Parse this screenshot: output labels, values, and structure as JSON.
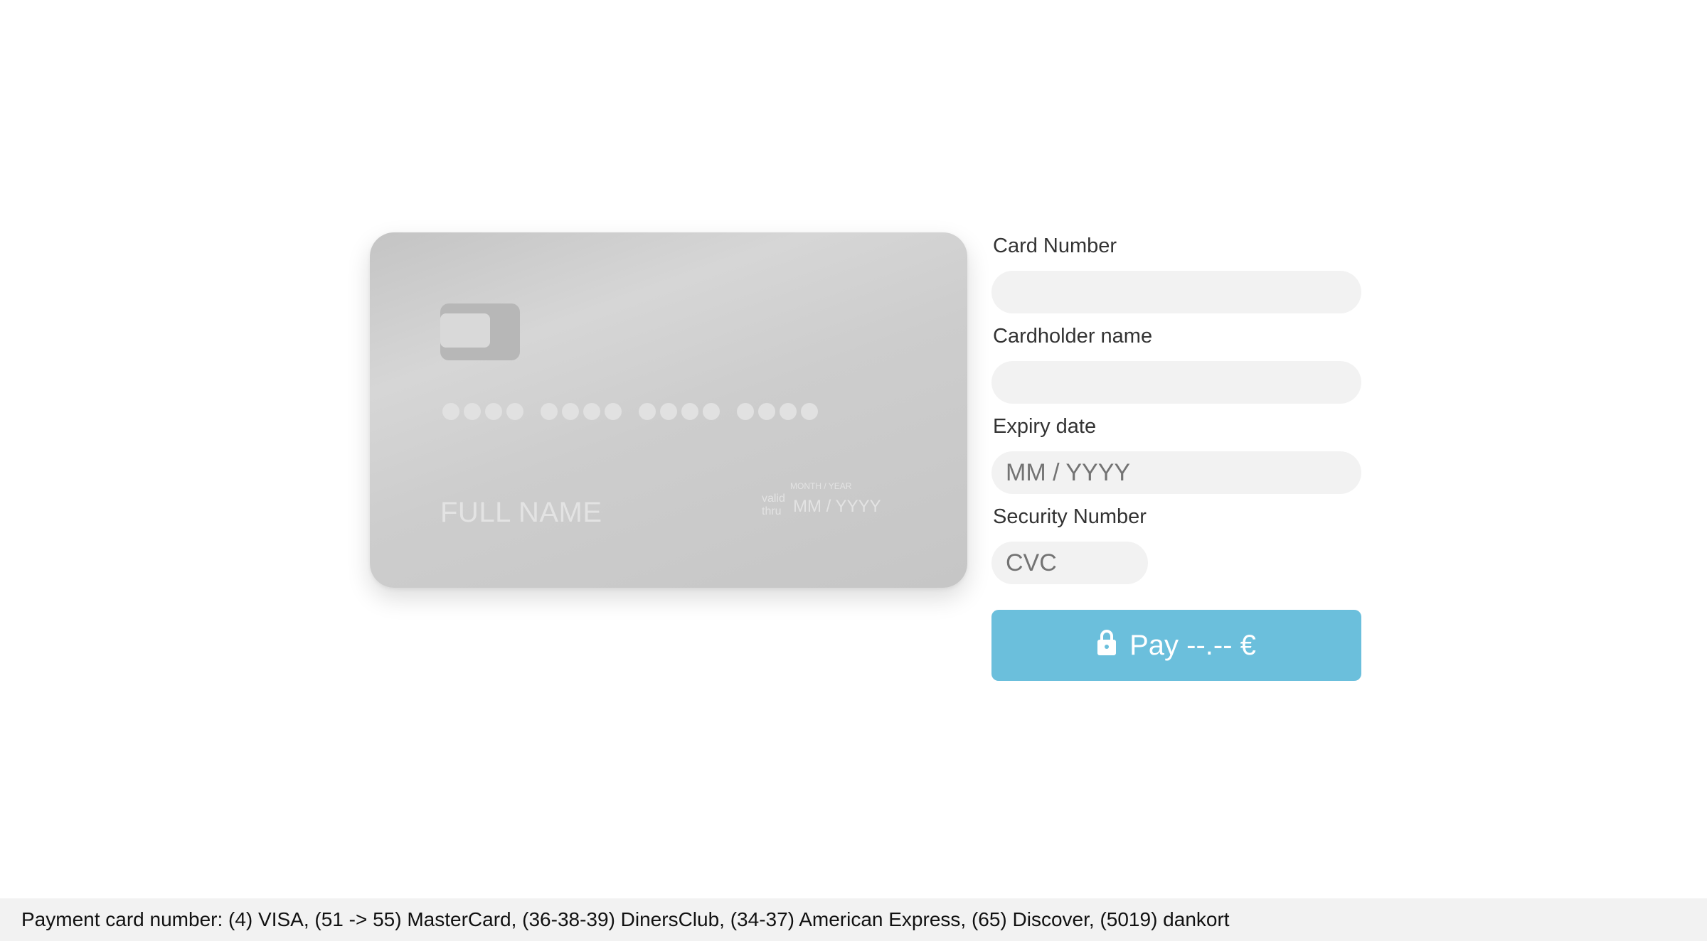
{
  "card_preview": {
    "chip_icon": "card-chip-icon",
    "number_groups": 4,
    "digits_per_group": 4,
    "name": "FULL NAME",
    "valid_thru_label": "valid\nthru",
    "month_year_label": "MONTH / YEAR",
    "expiry": "MM / YYYY"
  },
  "form": {
    "card_number": {
      "label": "Card Number",
      "value": "",
      "placeholder": ""
    },
    "cardholder_name": {
      "label": "Cardholder name",
      "value": "",
      "placeholder": ""
    },
    "expiry_date": {
      "label": "Expiry date",
      "value": "",
      "placeholder": "MM / YYYY"
    },
    "security_number": {
      "label": "Security Number",
      "value": "",
      "placeholder": "CVC"
    },
    "pay_button": {
      "label": "Pay --.-- €",
      "icon": "lock-icon",
      "color": "#6bbfdc"
    }
  },
  "footer": {
    "text": "Payment card number: (4) VISA, (51 -> 55) MasterCard, (36-38-39) DinersClub, (34-37) American Express, (65) Discover, (5019) dankort"
  }
}
